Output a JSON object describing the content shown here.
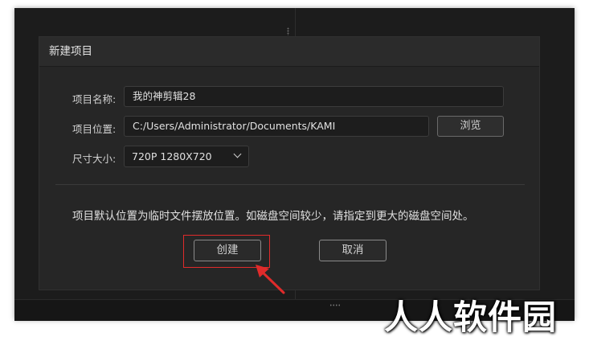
{
  "dialog": {
    "title": "新建项目",
    "name_label": "项目名称:",
    "name_value": "我的神剪辑28",
    "location_label": "项目位置:",
    "location_value": "C:/Users/Administrator/Documents/KAMI",
    "browse_label": "浏览",
    "size_label": "尺寸大小:",
    "size_value": "720P 1280X720",
    "notice": "项目默认位置为临时文件摆放位置。如磁盘空间较少，请指定到更大的磁盘空间处。",
    "create_label": "创建",
    "cancel_label": "取消"
  },
  "annotation": {
    "highlight_color": "#e02b2b",
    "arrow_icon": "red-arrow-icon"
  },
  "watermark": {
    "text": "人人软件园"
  }
}
